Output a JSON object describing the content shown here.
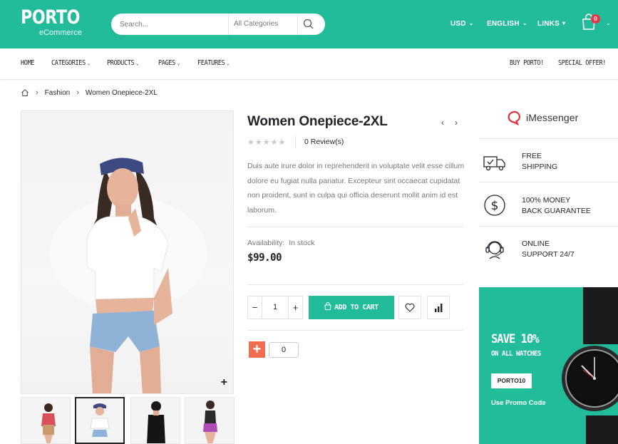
{
  "header": {
    "logo_main": "PORTO",
    "logo_sub": "eCommerce",
    "search_placeholder": "Search...",
    "search_category": "All Categories",
    "currency": "USD",
    "language": "ENGLISH",
    "links": "LINKS",
    "cart_count": "0"
  },
  "nav": {
    "items": [
      "HOME",
      "CATEGORIES",
      "PRODUCTS",
      "PAGES",
      "FEATURES"
    ],
    "right_items": [
      "BUY PORTO!",
      "SPECIAL OFFER!"
    ]
  },
  "breadcrumb": {
    "items": [
      "Fashion",
      "Women Onepiece-2XL"
    ]
  },
  "product": {
    "title": "Women Onepiece-2XL",
    "rating": 0,
    "reviews": "0 Review(s)",
    "description": "Duis aute irure dolor in reprehenderit in voluptate velit esse cillum dolore eu fugiat nulla pariatur. Excepteur sint occaecat cupidatat non proident, sunt in culpa qui officia deserunt mollit anim id est laborum.",
    "availability_label": "Availability:",
    "availability_value": "In stock",
    "price": "$99.00",
    "quantity": "1",
    "add_to_cart": "ADD TO CART",
    "share_count": "0"
  },
  "sidebar": {
    "brand": "iMessenger",
    "features": [
      {
        "icon": "truck-icon",
        "line1": "FREE",
        "line2": "SHIPPING"
      },
      {
        "icon": "dollar-icon",
        "line1": "100% MONEY",
        "line2": "BACK GUARANTEE"
      },
      {
        "icon": "support-icon",
        "line1": "ONLINE",
        "line2": "SUPPORT 24/7"
      }
    ],
    "promo": {
      "title": "SAVE 10%",
      "subtitle": "ON ALL WATCHES",
      "code": "PORTO10",
      "use_text": "Use Promo Code"
    }
  },
  "colors": {
    "brand": "#22bc9a",
    "text": "#222529",
    "muted": "#777777",
    "share": "#f26c4f"
  }
}
